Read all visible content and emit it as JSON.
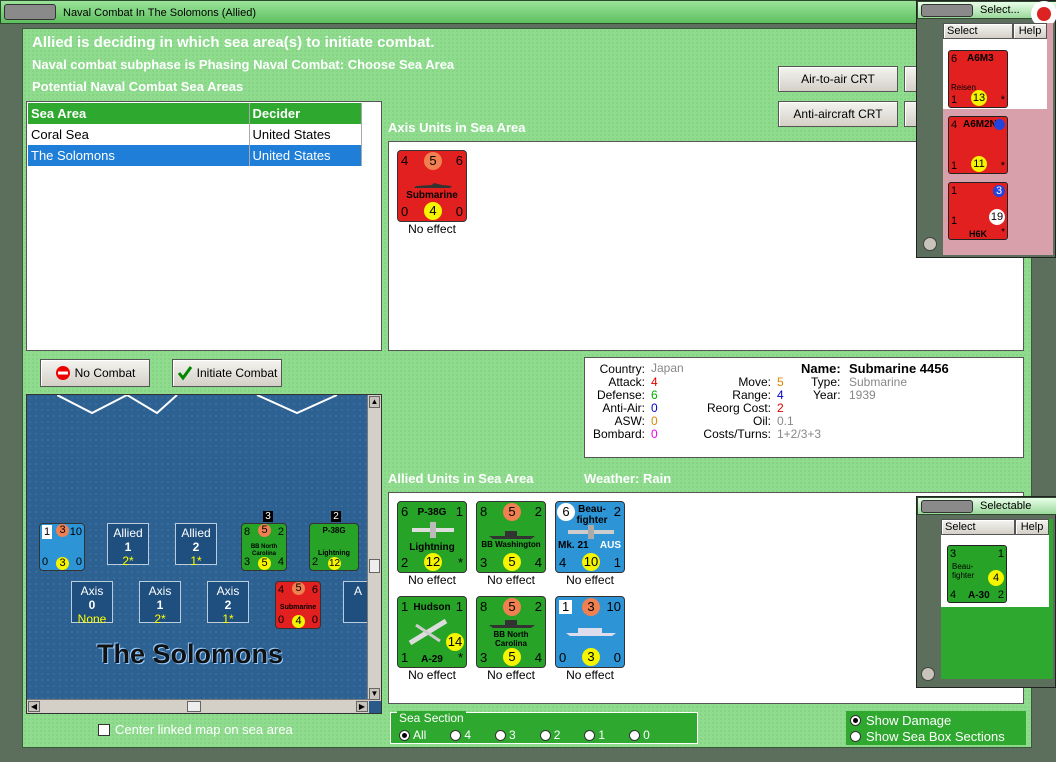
{
  "window": {
    "title": "Naval Combat In The Solomons (Allied)"
  },
  "messages": {
    "line1": "Allied is deciding in which sea area(s) to initiate combat.",
    "line2": "Naval combat subphase is Phasing Naval Combat: Choose Sea Area",
    "line3": "Potential Naval Combat Sea Areas"
  },
  "crt_buttons": {
    "air_to_air": "Air-to-air CRT",
    "anti_aircraft": "Anti-aircraft CRT"
  },
  "sea_table": {
    "headers": [
      "Sea Area",
      "Decider"
    ],
    "rows": [
      {
        "area": "Coral Sea",
        "decider": "United States"
      },
      {
        "area": "The Solomons",
        "decider": "United States"
      }
    ]
  },
  "axis_section": {
    "title": "Axis Units in Sea Area",
    "units": [
      {
        "name": "Submarine",
        "tl": "4",
        "tc": "5",
        "tr": "6",
        "bl": "0",
        "bc": "4",
        "br": "0",
        "effect": "No effect"
      }
    ]
  },
  "buttons": {
    "no_combat": "No Combat",
    "initiate_combat": "Initiate Combat"
  },
  "unit_info": {
    "country_label": "Country:",
    "country": "Japan",
    "attack_label": "Attack:",
    "attack": "4",
    "defense_label": "Defense:",
    "defense": "6",
    "antiair_label": "Anti-Air:",
    "antiair": "0",
    "asw_label": "ASW:",
    "asw": "0",
    "bombard_label": "Bombard:",
    "bombard": "0",
    "move_label": "Move:",
    "move": "5",
    "range_label": "Range:",
    "range": "4",
    "reorg_label": "Reorg Cost:",
    "reorg": "2",
    "oil_label": "Oil:",
    "oil": "0.1",
    "costs_label": "Costs/Turns:",
    "costs": "1+2/3+3",
    "name_label": "Name:",
    "name": "Submarine 4456",
    "type_label": "Type:",
    "type": "Submarine",
    "year_label": "Year:",
    "year": "1939"
  },
  "allied_section": {
    "title": "Allied Units in Sea Area",
    "weather": "Weather:  Rain",
    "units": [
      {
        "name": "P-38G",
        "sub": "Lightning",
        "tl": "6",
        "tr": "1",
        "bl": "2",
        "bc": "12",
        "br": "*",
        "effect": "No effect",
        "color": "green"
      },
      {
        "name": "BB Washington",
        "tl": "8",
        "tc": "5",
        "tr": "2",
        "bl": "3",
        "bc": "5",
        "br": "4",
        "effect": "No effect",
        "color": "green"
      },
      {
        "name": "Beau-fighter",
        "sub": "Mk. 21",
        "sub2": "AUS",
        "tl": "6",
        "tr": "2",
        "bl": "4",
        "bc": "10",
        "br": "1",
        "effect": "No effect",
        "color": "blue"
      },
      {
        "name": "Hudson",
        "sub": "A-29",
        "tl": "1",
        "tr": "1",
        "bl": "1",
        "bc": "14",
        "br": "*",
        "effect": "No effect",
        "color": "green"
      },
      {
        "name": "BB North Carolina",
        "tl": "8",
        "tc": "5",
        "tr": "2",
        "bl": "3",
        "bc": "5",
        "br": "4",
        "effect": "No effect",
        "color": "green"
      },
      {
        "name": "",
        "tl": "1",
        "tc": "3",
        "tr": "10",
        "bl": "0",
        "bc": "3",
        "br": "0",
        "effect": "No effect",
        "color": "blue"
      }
    ]
  },
  "map": {
    "sea_name": "The Solomons",
    "allied_boxes": [
      {
        "label": "Allied",
        "num": "1",
        "sub": "2*"
      },
      {
        "label": "Allied",
        "num": "2",
        "sub": "1*"
      }
    ],
    "axis_boxes": [
      {
        "label": "Axis",
        "num": "0",
        "sub": "None"
      },
      {
        "label": "Axis",
        "num": "1",
        "sub": "2*"
      },
      {
        "label": "Axis",
        "num": "2",
        "sub": "1*"
      },
      {
        "label": "A"
      }
    ],
    "counter_a": {
      "tl": "1",
      "tc": "3",
      "tr": "10",
      "bl": "0",
      "bc": "3",
      "br": "0"
    },
    "counter_b": {
      "name": "BB North Carolina",
      "tl": "8",
      "tc": "5",
      "tr": "2",
      "bl": "3",
      "bc": "5",
      "br": "4",
      "stack": "3"
    },
    "counter_c": {
      "name": "P-38G",
      "sub": "Lightning",
      "bl": "2",
      "bc": "12",
      "stack": "2"
    },
    "counter_d": {
      "name": "Submarine",
      "tl": "4",
      "tc": "5",
      "tr": "6",
      "bl": "0",
      "bc": "4",
      "br": "0"
    }
  },
  "center_linked": "Center linked map on sea area",
  "sea_section": {
    "title": "Sea Section",
    "options": [
      "All",
      "4",
      "3",
      "2",
      "1",
      "0"
    ],
    "selected": "All"
  },
  "show_options": {
    "damage": "Show Damage",
    "sea_box": "Show Sea Box Sections"
  },
  "select_top": {
    "title": "Select...",
    "tabs": [
      "Select",
      "Help"
    ],
    "units": [
      {
        "name": "A6M3",
        "sub": "Reisen",
        "tl": "6",
        "bl": "1",
        "bc": "13",
        "br": "*"
      },
      {
        "name": "A6M2N",
        "tl": "4",
        "bl": "1",
        "bc": "11",
        "br": "*"
      },
      {
        "name": "H6K",
        "tl": "1",
        "tr": "3",
        "bl": "1",
        "bc": "19",
        "br": "*"
      }
    ]
  },
  "select_bottom": {
    "title": "Selectable",
    "tabs": [
      "Select",
      "Help"
    ],
    "unit": {
      "name": "Beau-fighter",
      "sub": "A-30",
      "tl": "3",
      "tr": "1",
      "bl": "4",
      "bc": "4",
      "br": "2"
    }
  },
  "colors": {
    "green_header": "#2ea82e",
    "counter_red": "#e32020",
    "counter_green": "#27a327",
    "counter_blue": "#2d94d6",
    "sea_blue": "#1f4f7f",
    "background": "#8fdc8f"
  }
}
